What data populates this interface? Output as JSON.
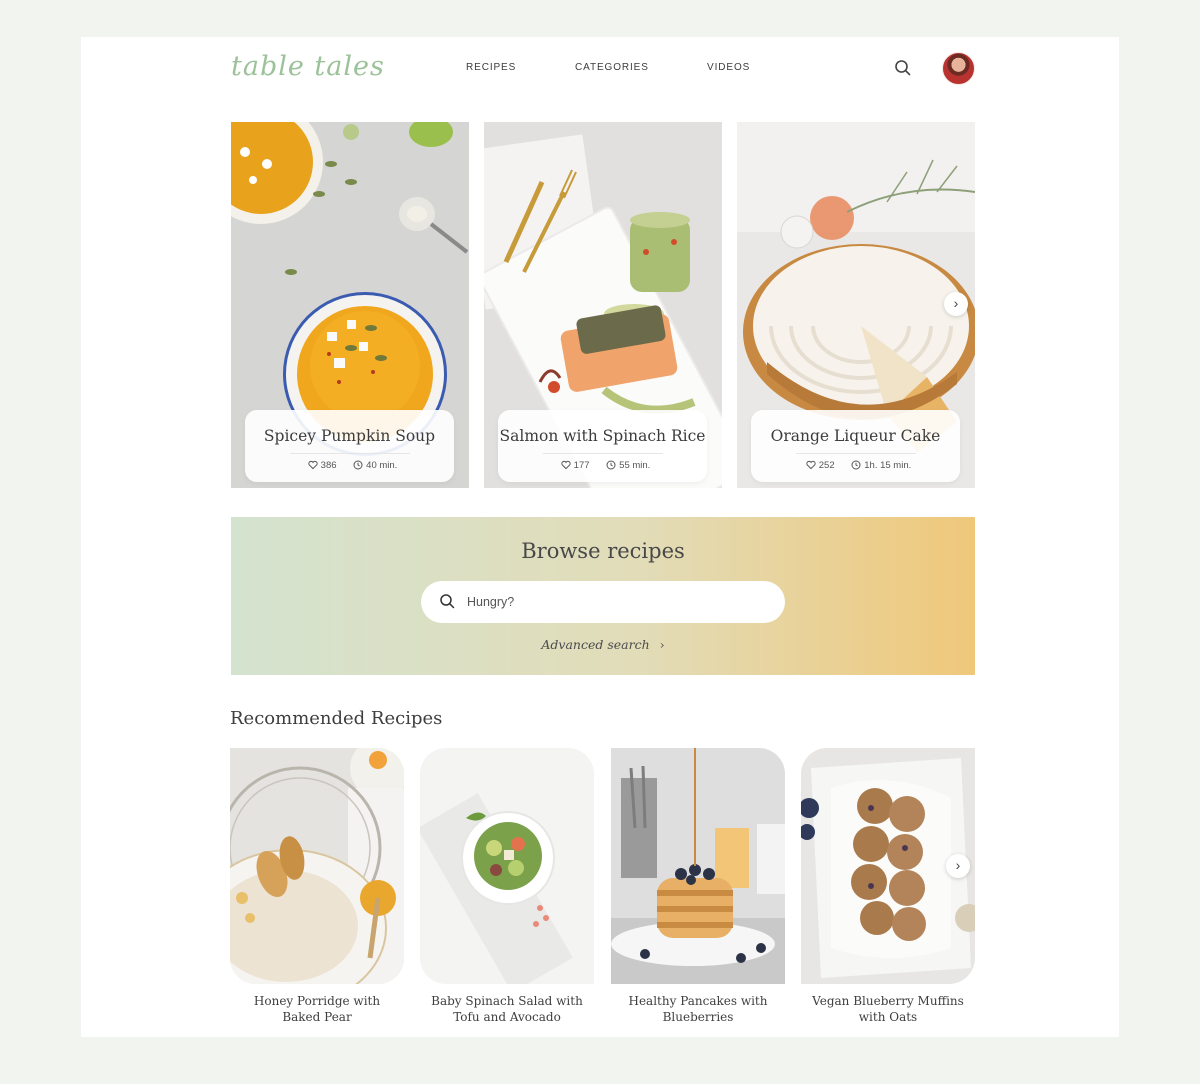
{
  "header": {
    "logo": "table tales",
    "nav": [
      "RECIPES",
      "CATEGORIES",
      "VIDEOS"
    ]
  },
  "featured": [
    {
      "title": "Spicey Pumpkin Soup",
      "likes": "386",
      "time": "40 min."
    },
    {
      "title": "Salmon with Spinach Rice",
      "likes": "177",
      "time": "55 min."
    },
    {
      "title": "Orange Liqueur Cake",
      "likes": "252",
      "time": "1h. 15 min."
    }
  ],
  "browse": {
    "title": "Browse recipes",
    "search_placeholder": "Hungry?",
    "advanced_link": "Advanced search"
  },
  "recommended": {
    "heading": "Recommended Recipes",
    "items": [
      {
        "line1": "Honey Porridge with",
        "line2": "Baked Pear"
      },
      {
        "line1": "Baby Spinach Salad with",
        "line2": "Tofu and Avocado"
      },
      {
        "line1": "Healthy Pancakes with",
        "line2": "Blueberries"
      },
      {
        "line1": "Vegan Blueberry Muffins",
        "line2": "with Oats"
      }
    ]
  },
  "colors": {
    "logo": "#9cc29a",
    "banner_start": "#d4e3cf",
    "banner_end": "#efc87a"
  }
}
